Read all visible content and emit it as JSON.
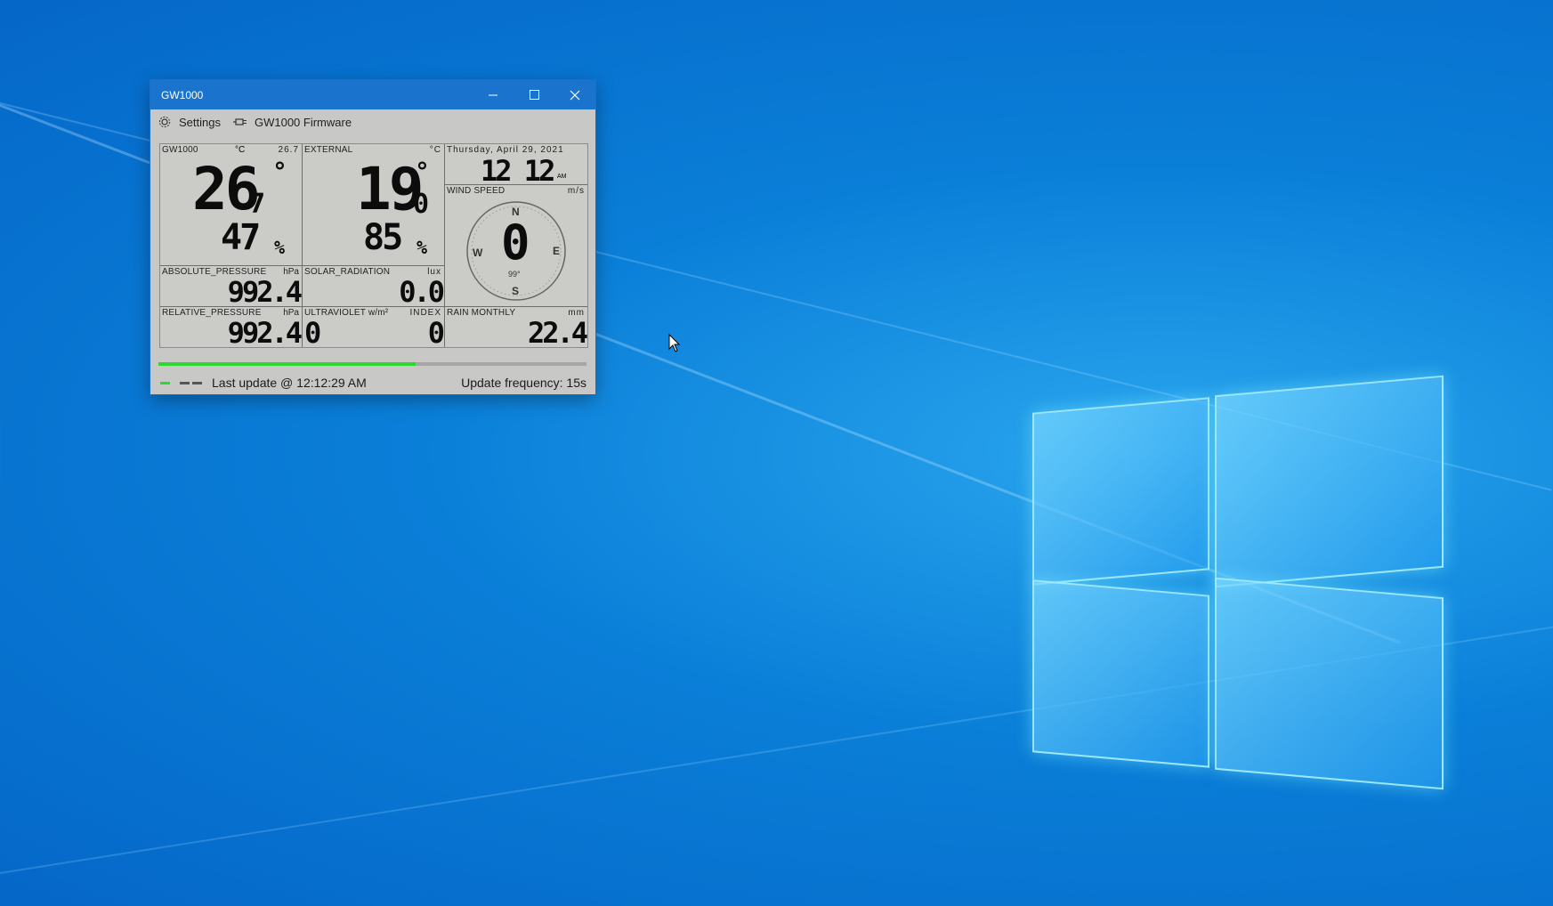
{
  "window": {
    "title": "GW1000",
    "minimize_glyph": "–",
    "maximize_glyph": "□",
    "close_glyph": "✕"
  },
  "menu": {
    "settings_label": "Settings",
    "firmware_label": "GW1000 Firmware",
    "settings_icon": "gear-icon",
    "firmware_icon": "plug-icon"
  },
  "indoor": {
    "label": "GW1000",
    "unit": "°C",
    "small_value": "26.7",
    "temp_int": "26",
    "temp_dec": "7",
    "degree": "°",
    "humidity": "47",
    "pct": "%"
  },
  "external": {
    "label": "EXTERNAL",
    "unit": "°C",
    "temp_int": "19",
    "temp_dec": "0",
    "degree": "°",
    "humidity": "85",
    "pct": "%"
  },
  "clock": {
    "date": "Thursday, April 29, 2021",
    "time": "12 12",
    "ampm": "AM"
  },
  "wind": {
    "label": "WIND SPEED",
    "unit": "m/s",
    "value": "0",
    "north": "N",
    "south": "S",
    "east": "E",
    "west": "W",
    "direction": "99°"
  },
  "abs_pressure": {
    "label": "ABSOLUTE_PRESSURE",
    "unit": "hPa",
    "value": "992.4"
  },
  "solar": {
    "label": "SOLAR_RADIATION",
    "unit": "lux",
    "value": "0.0"
  },
  "rel_pressure": {
    "label": "RELATIVE_PRESSURE",
    "unit": "hPa",
    "value": "992.4"
  },
  "uv": {
    "label": "ULTRAVIOLET w/m²",
    "unit": "INDEX",
    "value_left": "0",
    "value_right": "0"
  },
  "rain": {
    "label": "RAIN MONTHLY",
    "unit": "mm",
    "value": "22.4"
  },
  "status": {
    "progress_fraction": 0.6,
    "last_update": "Last update @ 12:12:29 AM",
    "frequency": "Update frequency: 15s",
    "green_color": "#2ed82e",
    "dash_color": "#555555"
  }
}
